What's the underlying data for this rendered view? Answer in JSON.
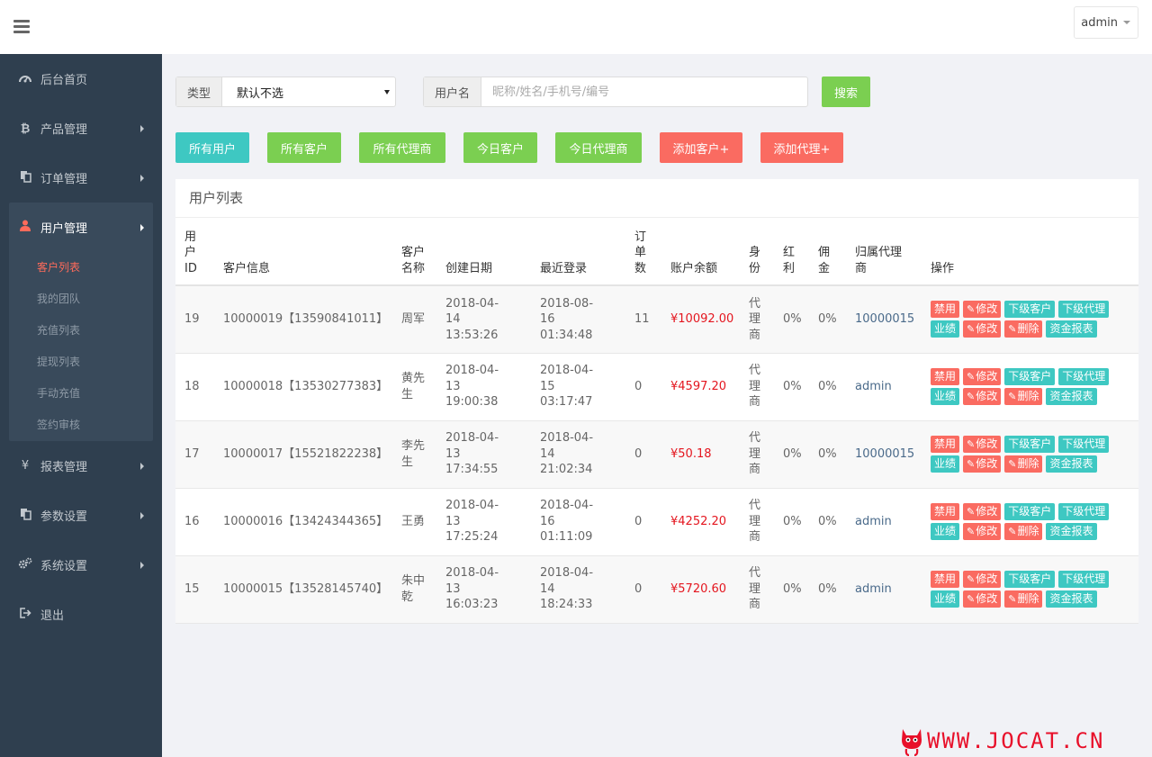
{
  "header": {
    "user": "admin"
  },
  "sidebar": {
    "items": [
      {
        "label": "后台首页",
        "icon": "dashboard-icon"
      },
      {
        "label": "产品管理",
        "icon": "bitcoin-icon"
      },
      {
        "label": "订单管理",
        "icon": "copy-icon"
      },
      {
        "label": "用户管理",
        "icon": "user-icon"
      },
      {
        "label": "报表管理",
        "icon": "yen-icon"
      },
      {
        "label": "参数设置",
        "icon": "copy-icon"
      },
      {
        "label": "系统设置",
        "icon": "gears-icon"
      },
      {
        "label": "退出",
        "icon": "sign-out-icon"
      }
    ],
    "submenu": [
      "客户列表",
      "我的团队",
      "充值列表",
      "提现列表",
      "手动充值",
      "签约审核"
    ]
  },
  "filters": {
    "type_label": "类型",
    "type_value": "默认不选",
    "name_label": "用户名",
    "name_placeholder": "昵称/姓名/手机号/编号",
    "search": "搜索"
  },
  "buttons": [
    "所有用户",
    "所有客户",
    "所有代理商",
    "今日客户",
    "今日代理商",
    "添加客户+",
    "添加代理+"
  ],
  "panel": {
    "title": "用户列表",
    "headers": [
      "用户ID",
      "客户信息",
      "客户名称",
      "创建日期",
      "最近登录",
      "订单数",
      "账户余额",
      "身份",
      "红利",
      "佣金",
      "归属代理商",
      "操作"
    ],
    "ops": [
      "禁用",
      "修改",
      "下级客户",
      "下级代理",
      "业绩",
      "修改",
      "删除",
      "资金报表"
    ],
    "rows": [
      {
        "id": "19",
        "info": "10000019【13590841011】",
        "name": "周军",
        "created": "2018-04-14 13:53:26",
        "last": "2018-08-16 01:34:48",
        "orders": "11",
        "balance": "¥10092.00",
        "role": "代理商",
        "bonus": "0%",
        "commission": "0%",
        "agent": "10000015"
      },
      {
        "id": "18",
        "info": "10000018【13530277383】",
        "name": "黄先生",
        "created": "2018-04-13 19:00:38",
        "last": "2018-04-15 03:17:47",
        "orders": "0",
        "balance": "¥4597.20",
        "role": "代理商",
        "bonus": "0%",
        "commission": "0%",
        "agent": "admin"
      },
      {
        "id": "17",
        "info": "10000017【15521822238】",
        "name": "李先生",
        "created": "2018-04-13 17:34:55",
        "last": "2018-04-14 21:02:34",
        "orders": "0",
        "balance": "¥50.18",
        "role": "代理商",
        "bonus": "0%",
        "commission": "0%",
        "agent": "10000015"
      },
      {
        "id": "16",
        "info": "10000016【13424344365】",
        "name": "王勇",
        "created": "2018-04-13 17:25:24",
        "last": "2018-04-16 01:11:09",
        "orders": "0",
        "balance": "¥4252.20",
        "role": "代理商",
        "bonus": "0%",
        "commission": "0%",
        "agent": "admin"
      },
      {
        "id": "15",
        "info": "10000015【13528145740】",
        "name": "朱中乾",
        "created": "2018-04-13 16:03:23",
        "last": "2018-04-14 18:24:33",
        "orders": "0",
        "balance": "¥5720.60",
        "role": "代理商",
        "bonus": "0%",
        "commission": "0%",
        "agent": "admin"
      }
    ]
  },
  "watermark": "WWW.JOCAT.CN",
  "colors": {
    "sidebar": "#2f3f4f",
    "accent_red": "#fa6b61",
    "teal": "#3ec8c2",
    "green": "#7bcf51",
    "balance": "#e4161f"
  }
}
